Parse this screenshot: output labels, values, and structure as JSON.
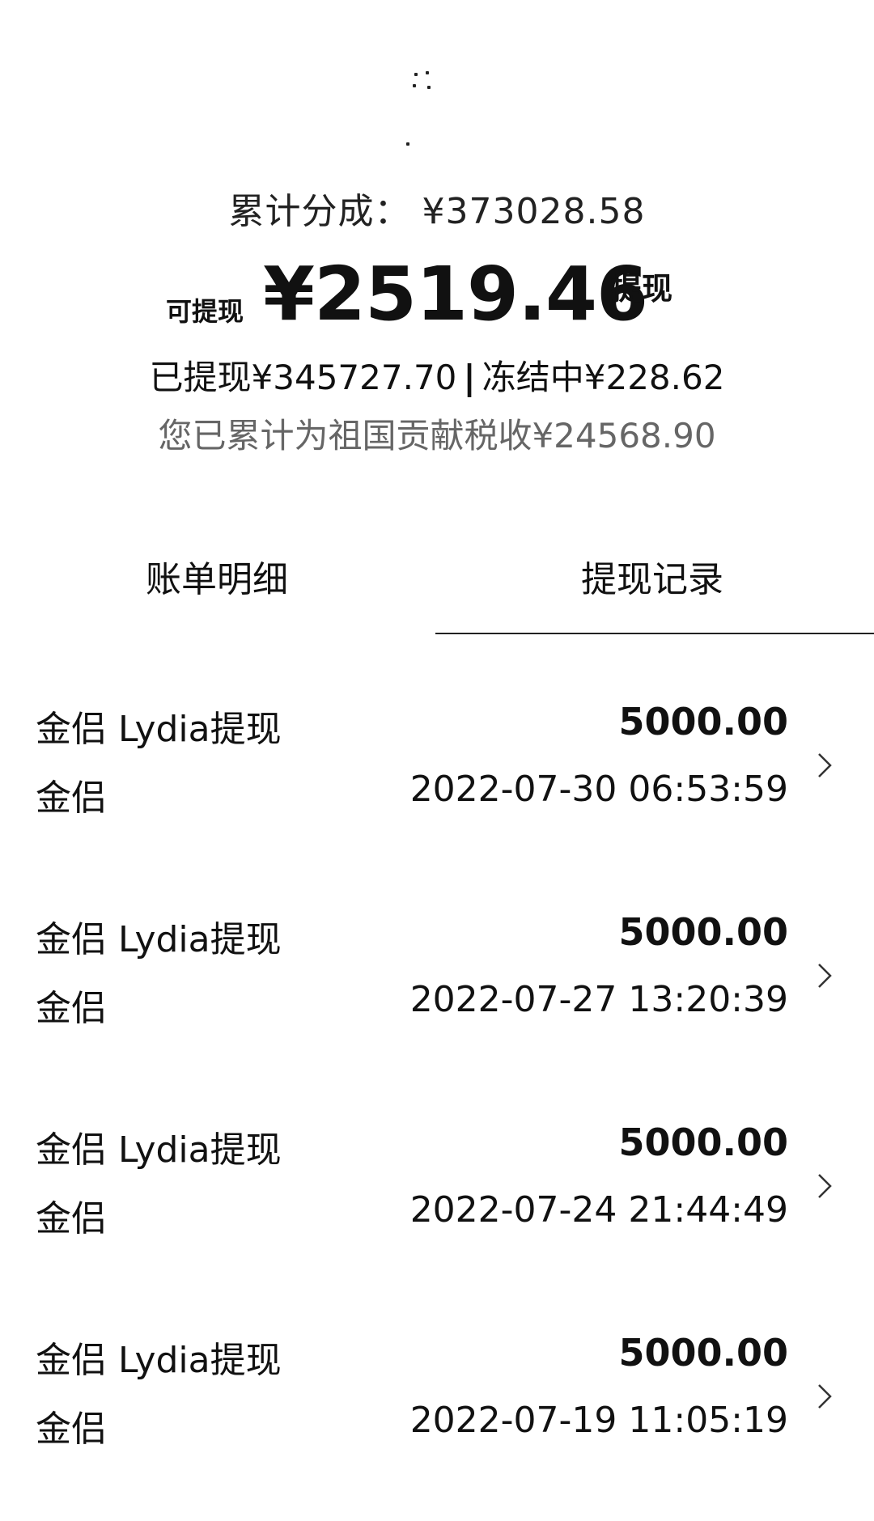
{
  "summary": {
    "cumulative_label": "累计分成：",
    "cumulative_value": "¥373028.58",
    "available_label": "可提现",
    "available_amount": "¥2519.46",
    "withdraw_button": "提现",
    "withdrawn_label": "已提现",
    "withdrawn_value": "¥345727.70",
    "separator": "|",
    "frozen_label": "冻结中",
    "frozen_value": "¥228.62",
    "tax_text": "您已累计为祖国贡献税收¥24568.90"
  },
  "tabs": {
    "bill_detail": "账单明细",
    "withdraw_records": "提现记录",
    "active": "withdraw_records"
  },
  "records": [
    {
      "title": "金侣 Lydia提现",
      "sub": "金侣",
      "amount": "5000.00",
      "time": "2022-07-30 06:53:59"
    },
    {
      "title": "金侣 Lydia提现",
      "sub": "金侣",
      "amount": "5000.00",
      "time": "2022-07-27 13:20:39"
    },
    {
      "title": "金侣 Lydia提现",
      "sub": "金侣",
      "amount": "5000.00",
      "time": "2022-07-24 21:44:49"
    },
    {
      "title": "金侣 Lydia提现",
      "sub": "金侣",
      "amount": "5000.00",
      "time": "2022-07-19 11:05:19"
    }
  ],
  "icons": {
    "record_chevron": "chevron-right-icon"
  }
}
